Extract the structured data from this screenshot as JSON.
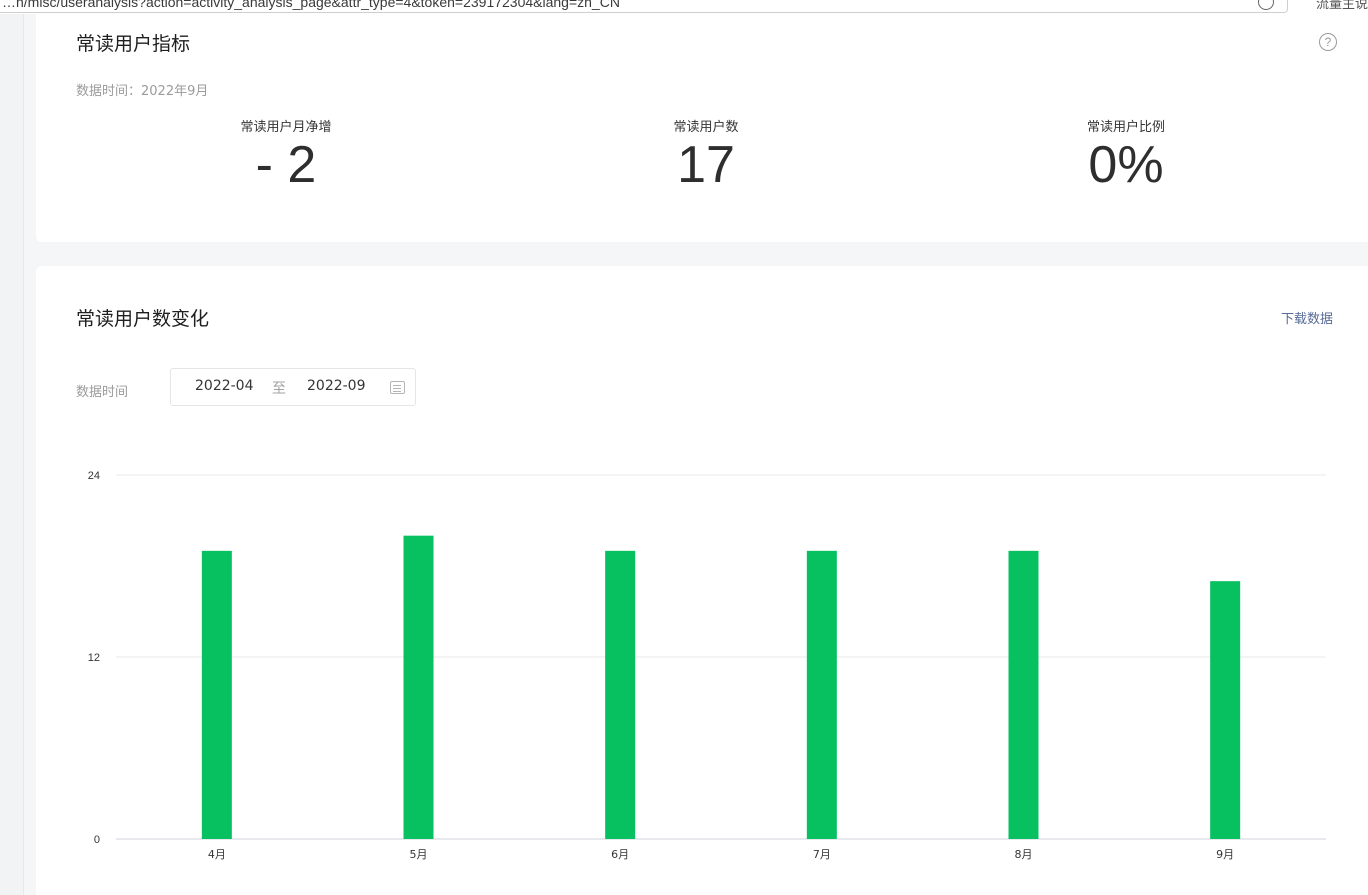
{
  "browser": {
    "url": "…n/misc/useranalysis?action=activity_analysis_page&attr_type=4&token=239172304&lang=zh_CN",
    "ext_label": "流量主说"
  },
  "metrics_card": {
    "title": "常读用户指标",
    "help_icon": "question-circle-icon",
    "data_time": "数据时间：2022年9月",
    "items": [
      {
        "label": "常读用户月净增",
        "value": "- 2"
      },
      {
        "label": "常读用户数",
        "value": "17"
      },
      {
        "label": "常读用户比例",
        "value": "0%"
      }
    ]
  },
  "chart_card": {
    "title": "常读用户数变化",
    "download_label": "下载数据",
    "range_label": "数据时间",
    "range_start": "2022-04",
    "range_sep": "至",
    "range_end": "2022-09",
    "calendar_icon": "calendar-icon"
  },
  "chart_data": {
    "type": "bar",
    "categories": [
      "4月",
      "5月",
      "6月",
      "7月",
      "8月",
      "9月"
    ],
    "values": [
      19,
      20,
      19,
      19,
      19,
      17
    ],
    "ylim": [
      0,
      24
    ],
    "yticks": [
      "0",
      "12",
      "24"
    ],
    "grid": true,
    "bar_color": "#07c160",
    "title": "",
    "xlabel": "",
    "ylabel": ""
  }
}
